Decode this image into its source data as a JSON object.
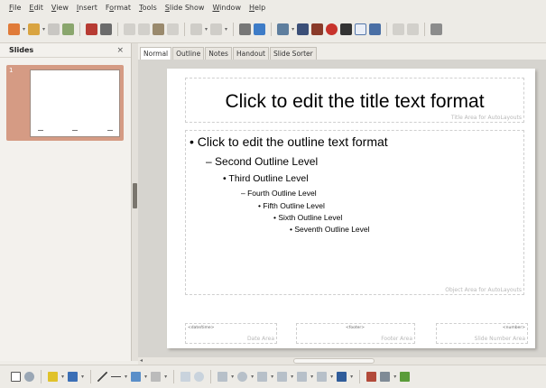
{
  "menu": [
    {
      "label": "File",
      "key": "F",
      "rest": "ile"
    },
    {
      "label": "Edit",
      "key": "E",
      "rest": "dit"
    },
    {
      "label": "View",
      "key": "V",
      "rest": "iew"
    },
    {
      "label": "Insert",
      "key": "I",
      "rest": "nsert"
    },
    {
      "label": "Format",
      "key": "o",
      "pre": "F",
      "rest": "rmat"
    },
    {
      "label": "Tools",
      "key": "T",
      "rest": "ools"
    },
    {
      "label": "Slide Show",
      "key": "S",
      "rest": "lide Show"
    },
    {
      "label": "Window",
      "key": "W",
      "rest": "indow"
    },
    {
      "label": "Help",
      "key": "H",
      "rest": "elp"
    }
  ],
  "slides_pane": {
    "title": "Slides",
    "close": "×",
    "thumb_number": "1"
  },
  "tabs": [
    "Normal",
    "Outline",
    "Notes",
    "Handout",
    "Slide Sorter"
  ],
  "active_tab": "Normal",
  "slide": {
    "title": "Click to edit the title text format",
    "title_area_label": "Title Area for AutoLayouts",
    "object_area_label": "Object Area for AutoLayouts",
    "outline": [
      {
        "bullet": "•",
        "text": "Click to edit the outline text format",
        "level": 1
      },
      {
        "bullet": "–",
        "text": "Second Outline Level",
        "level": 2
      },
      {
        "bullet": "•",
        "text": "Third Outline Level",
        "level": 3
      },
      {
        "bullet": "–",
        "text": "Fourth Outline Level",
        "level": 4
      },
      {
        "bullet": "•",
        "text": "Fifth Outline Level",
        "level": 5
      },
      {
        "bullet": "•",
        "text": "Sixth Outline Level",
        "level": 6
      },
      {
        "bullet": "•",
        "text": "Seventh Outline Level",
        "level": 7
      }
    ],
    "footer": {
      "date_placeholder": "<date/time>",
      "date_label": "Date Area",
      "footer_placeholder": "<footer>",
      "footer_label": "Footer Area",
      "number_placeholder": "<number>",
      "number_label": "Slide Number Area"
    }
  },
  "colors": {
    "thumb_selected": "#d59b84",
    "accent_orange": "#e8892b",
    "accent_red": "#c8332c",
    "accent_blue": "#3b6fb6",
    "accent_green": "#5a9c3a"
  }
}
